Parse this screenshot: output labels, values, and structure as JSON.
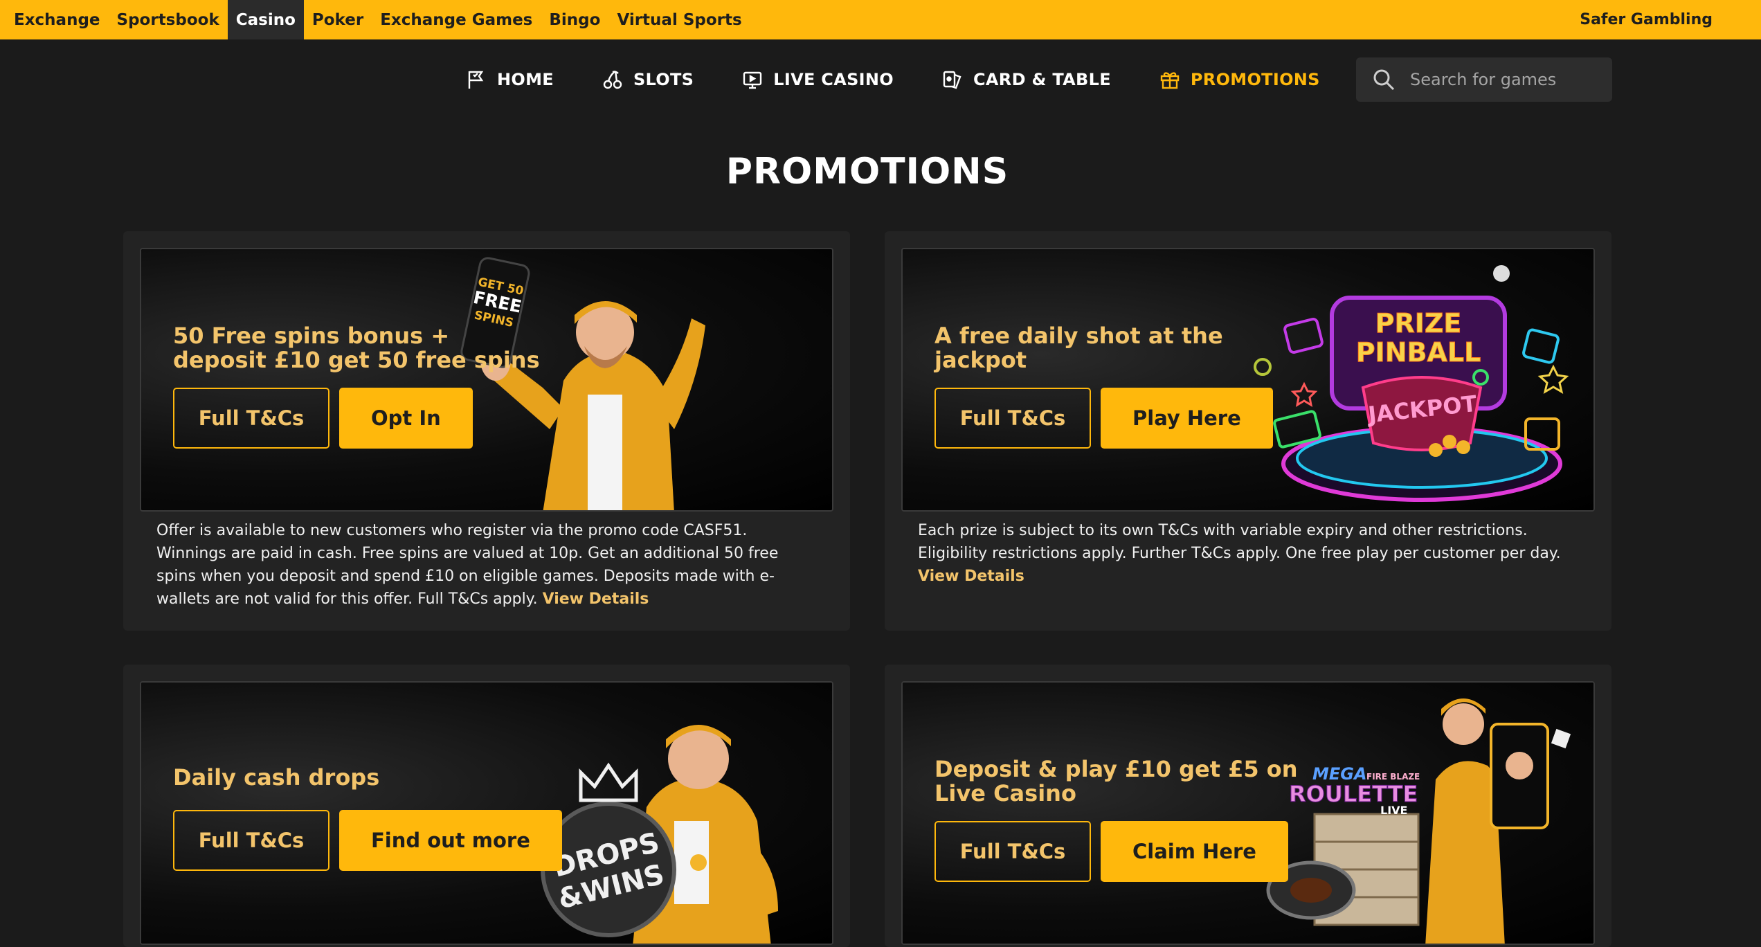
{
  "topbar": {
    "tabs": [
      "Exchange",
      "Sportsbook",
      "Casino",
      "Poker",
      "Exchange Games",
      "Bingo",
      "Virtual Sports"
    ],
    "active_tab": "Casino",
    "safer_gambling": "Safer Gambling"
  },
  "nav": {
    "items": [
      {
        "label": "HOME",
        "icon": "flag-icon"
      },
      {
        "label": "SLOTS",
        "icon": "cherries-icon"
      },
      {
        "label": "LIVE CASINO",
        "icon": "monitor-icon"
      },
      {
        "label": "CARD & TABLE",
        "icon": "cards-icon"
      },
      {
        "label": "PROMOTIONS",
        "icon": "gift-icon"
      }
    ],
    "active": "PROMOTIONS",
    "search_placeholder": "Search for games"
  },
  "page_title": "PROMOTIONS",
  "promos": [
    {
      "headline_line1": "50 Free spins bonus +",
      "headline_line2": "deposit £10 get 50 free spins",
      "terms_button": "Full T&Cs",
      "action_button": "Opt In",
      "phone_text_1": "GET 50",
      "phone_text_2": "FREE",
      "phone_text_3": "SPINS",
      "description": "Offer is available to new customers who register via the promo code CASF51. Winnings are paid in cash. Free spins are valued at 10p. Get an additional 50 free spins when you deposit and spend £10 on eligible games. Deposits made with e-wallets are not valid for this offer. Full T&Cs apply.",
      "details_link": "View Details"
    },
    {
      "headline_line1": "A free daily shot at the",
      "headline_line2": "jackpot",
      "terms_button": "Full T&Cs",
      "action_button": "Play Here",
      "art_text_1": "PRIZE",
      "art_text_2": "PINBALL",
      "art_text_3": "JACKPOT",
      "description": "Each prize is subject to its own T&Cs with variable expiry and other restrictions. Eligibility restrictions apply. Further T&Cs apply. One free play per customer per day.",
      "details_link": "View Details"
    },
    {
      "headline_line1": "Daily cash drops",
      "headline_line2": "",
      "terms_button": "Full T&Cs",
      "action_button": "Find out more",
      "art_text_1": "DROPS",
      "art_text_2": "&WINS"
    },
    {
      "headline_line1": "Deposit & play £10 get £5 on",
      "headline_line2": "Live Casino",
      "terms_button": "Full T&Cs",
      "action_button": "Claim Here",
      "art_text_1": "MEGA",
      "art_text_2": "FIRE BLAZE",
      "art_text_3": "ROULETTE",
      "art_text_4": "LIVE"
    }
  ],
  "colors": {
    "accent": "#ffb80c",
    "headline": "#f3c46b",
    "background": "#1b1b1b",
    "card": "#232323"
  }
}
